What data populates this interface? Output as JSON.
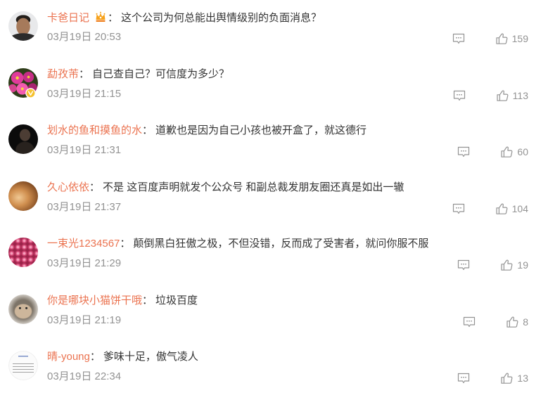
{
  "colors": {
    "username": "#eb7350",
    "comment_text": "#333333",
    "meta": "#939393",
    "verified_badge": "#f5c12e",
    "crown_badge": "#f7a21b"
  },
  "icons": {
    "reply": "comment-icon",
    "like": "thumb-up-icon"
  },
  "separator": "：",
  "comments": [
    {
      "username": "卡爸日记",
      "badge_icon": "crown-badge-icon",
      "text": "这个公司为何总能出舆情级别的负面消息？",
      "date": "03月19日 20:53",
      "likes": "159"
    },
    {
      "username": "勐孜芾",
      "avatar_badge_icon": "verified-badge-icon",
      "text": "自己查自己？可信度为多少？",
      "date": "03月19日 21:15",
      "likes": "113"
    },
    {
      "username": "划水的鱼和摸鱼的水",
      "text": "道歉也是因为自己小孩也被开盒了，就这德行",
      "date": "03月19日 21:31",
      "likes": "60"
    },
    {
      "username": "久心依依",
      "text": "不是 这百度声明就发个公众号 和副总裁发朋友圈还真是如出一辙",
      "date": "03月19日 21:37",
      "likes": "104"
    },
    {
      "username": "一束光1234567",
      "text": "颠倒黑白狂傲之极，不但没错，反而成了受害者，就问你服不服",
      "date": "03月19日 21:29",
      "likes": "19"
    },
    {
      "username": "你是哪块小猫饼干哦",
      "text": "垃圾百度",
      "date": "03月19日 21:19",
      "likes": "8"
    },
    {
      "username": "晴-young",
      "text": "爹味十足，傲气凌人",
      "date": "03月19日 22:34",
      "likes": "13"
    }
  ]
}
